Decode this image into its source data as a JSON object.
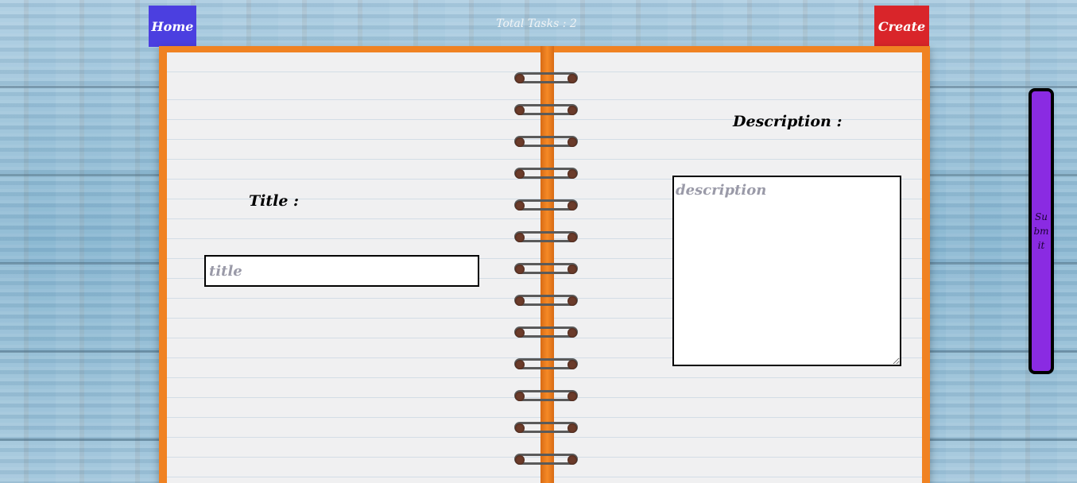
{
  "nav": {
    "home_label": "Home",
    "create_label": "Create",
    "task_count_text": "Total Tasks : 2"
  },
  "form": {
    "title_label": "Title :",
    "title_placeholder": "title",
    "title_value": "",
    "description_label": "Description :",
    "description_placeholder": "description",
    "description_value": "",
    "submit_label": "Submit"
  },
  "colors": {
    "home_button": "#4b3fe0",
    "create_button": "#d9252a",
    "submit_button": "#8a2be2",
    "notebook_cover": "#f08222"
  }
}
